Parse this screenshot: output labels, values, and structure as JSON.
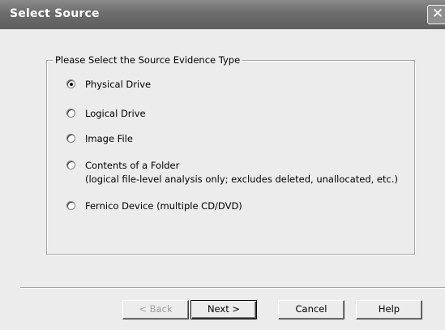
{
  "window": {
    "title": "Select Source",
    "close_glyph": "✕"
  },
  "group": {
    "legend": "Please Select the Source Evidence Type"
  },
  "options": [
    {
      "label": "Physical Drive",
      "checked": true
    },
    {
      "label": "Logical Drive",
      "checked": false
    },
    {
      "label": "Image File",
      "checked": false
    },
    {
      "label": "Contents of a Folder",
      "checked": false,
      "note": "(logical file-level analysis only; excludes deleted, unallocated, etc.)"
    },
    {
      "label": "Fernico Device (multiple CD/DVD)",
      "checked": false
    }
  ],
  "buttons": {
    "back": "< Back",
    "next": "Next >",
    "cancel": "Cancel",
    "help": "Help"
  }
}
